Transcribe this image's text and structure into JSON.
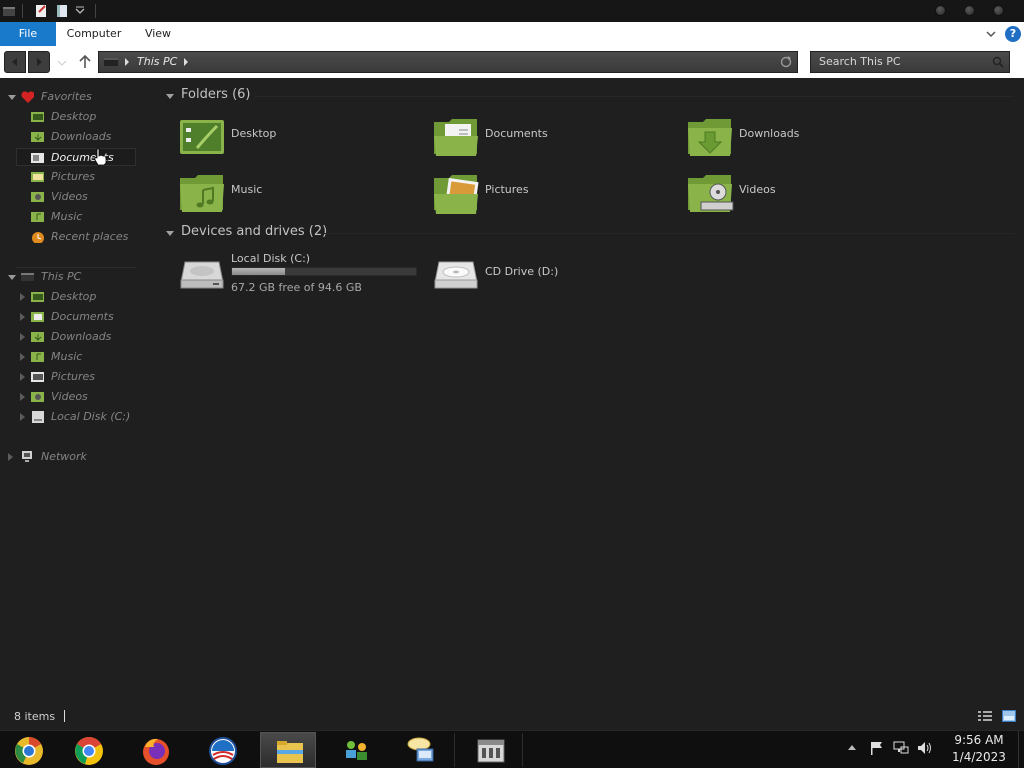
{
  "ribbon": {
    "tabs": [
      {
        "label": "File"
      },
      {
        "label": "Computer"
      },
      {
        "label": "View"
      }
    ],
    "help_label": "?"
  },
  "address": {
    "path": "This PC",
    "search_placeholder": "Search This PC"
  },
  "nav": {
    "favorites_label": "Favorites",
    "favorites": [
      {
        "label": "Desktop"
      },
      {
        "label": "Downloads"
      },
      {
        "label": "Documents"
      },
      {
        "label": "Pictures"
      },
      {
        "label": "Videos"
      },
      {
        "label": "Music"
      },
      {
        "label": "Recent places"
      }
    ],
    "thispc_label": "This PC",
    "thispc": [
      {
        "label": "Desktop"
      },
      {
        "label": "Documents"
      },
      {
        "label": "Downloads"
      },
      {
        "label": "Music"
      },
      {
        "label": "Pictures"
      },
      {
        "label": "Videos"
      },
      {
        "label": "Local Disk (C:)"
      }
    ],
    "network_label": "Network"
  },
  "content": {
    "folders_header": "Folders (6)",
    "folders": [
      {
        "label": "Desktop",
        "icon": "desktop-folder-icon"
      },
      {
        "label": "Documents",
        "icon": "documents-folder-icon"
      },
      {
        "label": "Downloads",
        "icon": "downloads-folder-icon"
      },
      {
        "label": "Music",
        "icon": "music-folder-icon"
      },
      {
        "label": "Pictures",
        "icon": "pictures-folder-icon"
      },
      {
        "label": "Videos",
        "icon": "videos-folder-icon"
      }
    ],
    "drives_header": "Devices and drives (2)",
    "drives": [
      {
        "label": "Local Disk (C:)",
        "free_text": "67.2 GB free of 94.6 GB",
        "used_fraction": 0.29,
        "icon": "hard-disk-icon"
      },
      {
        "label": "CD Drive (D:)",
        "icon": "cd-drive-icon"
      }
    ]
  },
  "status": {
    "items_text": "8 items"
  },
  "taskbar": {
    "apps": [
      {
        "name": "chrome-canary-icon"
      },
      {
        "name": "chrome-icon"
      },
      {
        "name": "firefox-icon"
      },
      {
        "name": "obama-logo-icon"
      },
      {
        "name": "file-explorer-icon"
      },
      {
        "name": "network-people-icon"
      },
      {
        "name": "messenger-icon"
      },
      {
        "name": "app-window-icon"
      }
    ],
    "clock_time": "9:56 AM",
    "clock_date": "1/4/2023"
  },
  "colors": {
    "accent": "#1979ca",
    "folder_green": "#8ab44a",
    "background": "#1f1f1f"
  }
}
